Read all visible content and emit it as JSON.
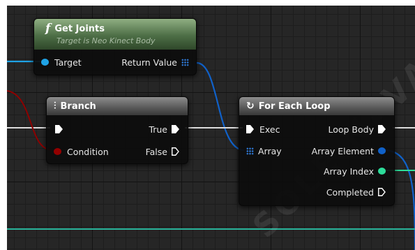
{
  "nodes": {
    "get_joints": {
      "title": "Get Joints",
      "subtitle": "Target is Neo Kinect Body",
      "icon": "function-f-icon",
      "pin_target": "Target",
      "pin_return": "Return Value"
    },
    "branch": {
      "title": "Branch",
      "icon": "branch-icon",
      "pin_true": "True",
      "pin_condition": "Condition",
      "pin_false": "False"
    },
    "for_each_loop": {
      "title": "For Each Loop",
      "icon": "loop-icon",
      "pin_exec": "Exec",
      "pin_loop_body": "Loop Body",
      "pin_array": "Array",
      "pin_array_element": "Array Element",
      "pin_array_index": "Array Index",
      "pin_completed": "Completed"
    }
  },
  "colors": {
    "object_pin": "#1fa3e6",
    "array_pin": "#2f79d6",
    "bool_pin": "#930000",
    "int_pin": "#2ddc9a",
    "exec_pin": "#ffffff",
    "canvas": "#262626"
  },
  "watermark": "SOLE NAVALE"
}
